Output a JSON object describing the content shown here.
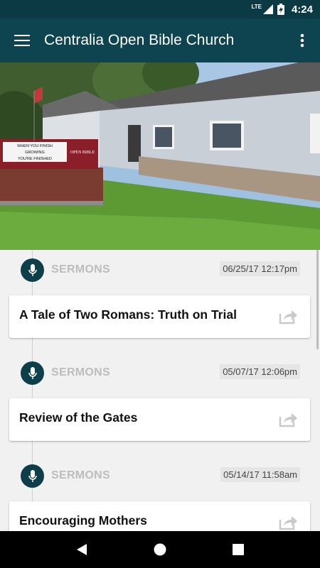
{
  "status_bar": {
    "network": "LTE",
    "time": "4:24"
  },
  "app_bar": {
    "title": "Centralia Open Bible Church",
    "menu_icon": "hamburger-menu-icon",
    "more_icon": "more-vert-icon"
  },
  "hero": {
    "sign_line1": "WHEN YOU FINISH",
    "sign_line2": "GROWING",
    "sign_line3": "YOU'RE FINISHED",
    "sign_logo": "OPEN BIBLE"
  },
  "feed": {
    "entries": [
      {
        "category": "SERMONS",
        "date": "06/25/17 12:17pm",
        "title": "A Tale of Two Romans: Truth on Trial"
      },
      {
        "category": "SERMONS",
        "date": "05/07/17 12:06pm",
        "title": "Review of the Gates"
      },
      {
        "category": "SERMONS",
        "date": "05/14/17 11:58am",
        "title": "Encouraging Mothers"
      }
    ]
  },
  "colors": {
    "primary": "#0d4450",
    "status": "#0c3a44",
    "badge": "#0d3f4a"
  }
}
